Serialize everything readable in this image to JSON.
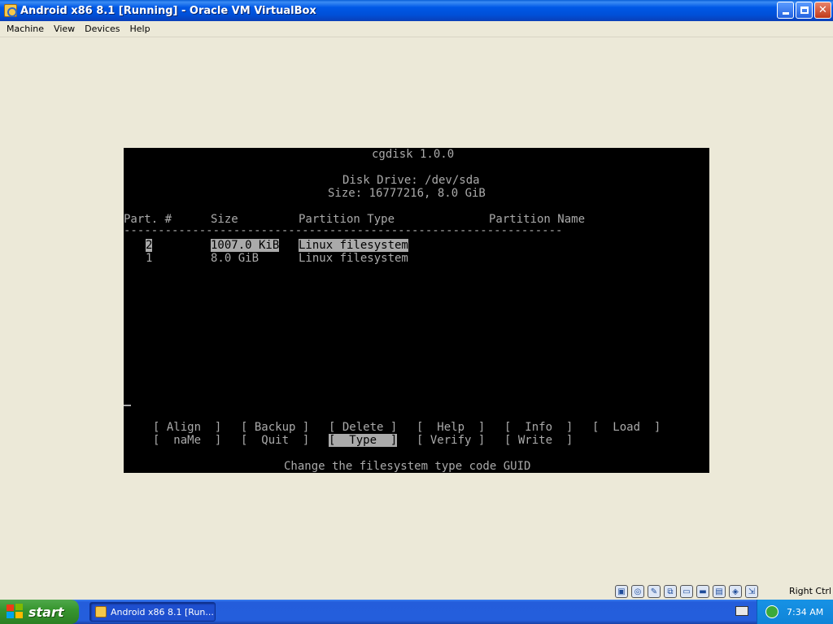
{
  "window": {
    "title": "Android x86 8.1 [Running] - Oracle VM VirtualBox",
    "minimize": "_",
    "maximize": "□",
    "close": "✕"
  },
  "menu": [
    "Machine",
    "View",
    "Devices",
    "Help"
  ],
  "console": {
    "app_title": "cgdisk 1.0.0",
    "disk_drive": "Disk Drive: /dev/sda",
    "size_line": "Size: 16777216, 8.0 GiB",
    "headers": {
      "part": "Part. #",
      "size": "Size",
      "type": "Partition Type",
      "name": "Partition Name"
    },
    "separator": "----------------------------------------------------------------",
    "partitions": [
      {
        "num": "2",
        "size": "1007.0 KiB",
        "type": "Linux filesystem",
        "name": ""
      },
      {
        "num": "1",
        "size": "8.0 GiB",
        "type": "Linux filesystem",
        "name": ""
      }
    ],
    "actions_row1": [
      "[ Align  ]",
      "[ Backup ]",
      "[ Delete ]",
      "[  Help  ]",
      "[  Info  ]",
      "[  Load  ]"
    ],
    "actions_row2": [
      "[  naMe  ]",
      "[  Quit  ]",
      "[  Type  ]",
      "[ Verify ]",
      "[ Write  ]"
    ],
    "selected_action": "[  Type  ]",
    "help_text": "Change the filesystem type code GUID"
  },
  "status": {
    "icons": [
      "hard-disk-icon",
      "optical-disc-icon",
      "usb-icon",
      "network-icon",
      "shared-folder-icon",
      "display-icon",
      "video-capture-icon",
      "cpu-icon",
      "mouse-integration-icon"
    ],
    "host_key": "Right Ctrl"
  },
  "taskbar": {
    "start": "start",
    "task_label": "Android x86 8.1 [Run...",
    "clock": "7:34 AM"
  }
}
